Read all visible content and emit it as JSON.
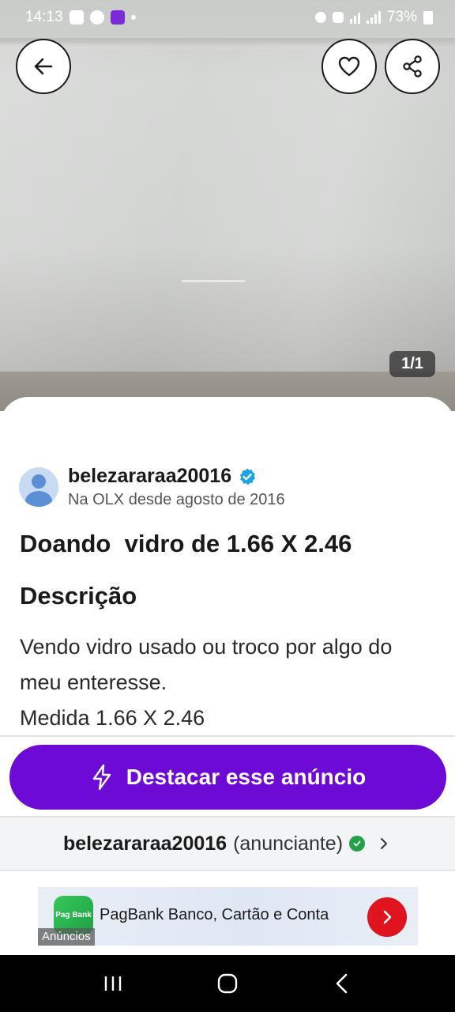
{
  "status_bar": {
    "time": "14:13",
    "battery": "73%"
  },
  "photo": {
    "counter": "1/1"
  },
  "seller": {
    "name": "belezararaa20016",
    "since": "Na OLX desde agosto de 2016"
  },
  "ad": {
    "title": "Doando  vidro de 1.66 X 2.46",
    "description_heading": "Descrição",
    "description_lines": [
      "Vendo vidro usado ou troco por algo do",
      "meu enteresse.",
      "Medida 1.66 X 2.46"
    ]
  },
  "cta": {
    "label": "Destacar esse anúncio"
  },
  "advertiser": {
    "name": "belezararaa20016",
    "role": "(anunciante)"
  },
  "banner": {
    "logo_text": "Pag Bank",
    "text": "PagBank Banco, Cartão e Conta",
    "ad_label": "Anúncios"
  },
  "colors": {
    "accent": "#6e0ad6",
    "verified": "#1fa3e0",
    "success": "#24a148"
  },
  "icons": {
    "back": "arrow-left-icon",
    "favorite": "heart-icon",
    "share": "share-icon",
    "boost": "lightning-icon",
    "chevron": "chevron-right-icon"
  }
}
